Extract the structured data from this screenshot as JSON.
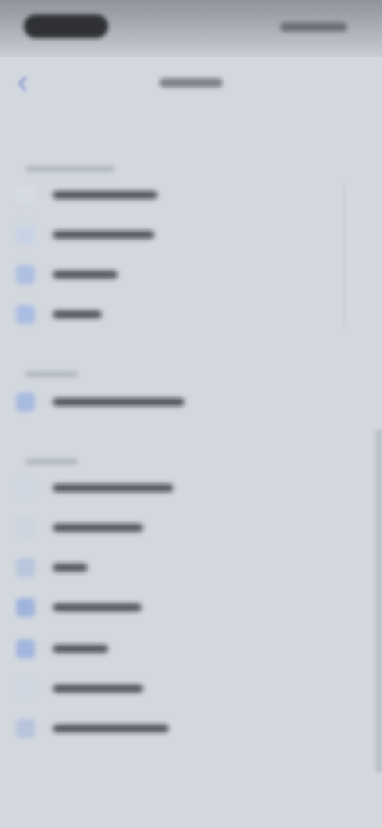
{
  "status_bar": {
    "time_text": "",
    "indicators_text": ""
  },
  "nav": {
    "title": "",
    "back_icon": "chevron-left-icon"
  },
  "sections": [
    {
      "header": "",
      "rows": [
        {
          "label": "",
          "icon": "settings-icon",
          "icon_color": "#d6dbe3"
        },
        {
          "label": "",
          "icon": "settings-icon",
          "icon_color": "#c8d3e5"
        },
        {
          "label": "",
          "icon": "settings-icon",
          "icon_color": "#aebfe0"
        },
        {
          "label": "",
          "icon": "settings-icon",
          "icon_color": "#aabde2"
        }
      ]
    },
    {
      "header": "",
      "rows": [
        {
          "label": "",
          "icon": "settings-icon",
          "icon_color": "#a7badf"
        }
      ]
    },
    {
      "header": "",
      "rows": [
        {
          "label": "",
          "icon": "settings-icon",
          "icon_color": "#cfd6e0"
        },
        {
          "label": "",
          "icon": "settings-icon",
          "icon_color": "#cdd4df"
        },
        {
          "label": "",
          "icon": "settings-icon",
          "icon_color": "#b9c6dc"
        },
        {
          "label": "",
          "icon": "settings-icon",
          "icon_color": "#9fb4dc"
        },
        {
          "label": "",
          "icon": "settings-icon",
          "icon_color": "#a3b6dd"
        },
        {
          "label": "",
          "icon": "settings-icon",
          "icon_color": "#cfd6e0"
        },
        {
          "label": "",
          "icon": "settings-icon",
          "icon_color": "#b7c4dc"
        }
      ]
    }
  ]
}
